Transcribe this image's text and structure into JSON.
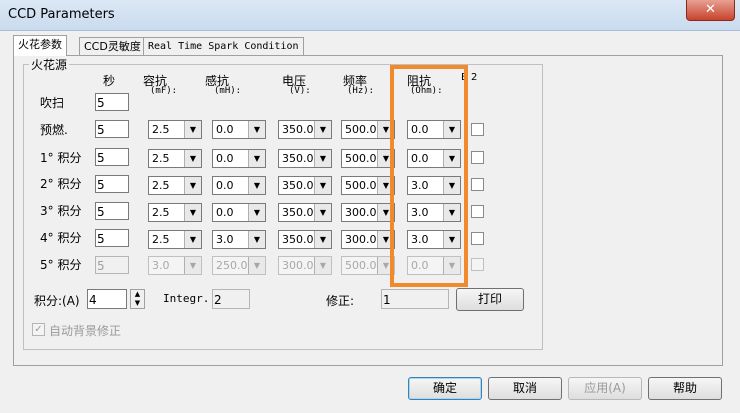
{
  "window": {
    "title": "CCD Parameters",
    "close": "✕"
  },
  "tabs": [
    "火花参数",
    "CCD灵敏度",
    "Real Time Spark Condition"
  ],
  "group_title": "火花源",
  "headers": {
    "sec": "秒",
    "capacitance": "容抗",
    "capacitance_unit": "(mF):",
    "inductance": "感抗",
    "inductance_unit": "(mH):",
    "voltage": "电压",
    "voltage_unit": "(V):",
    "frequency": "频率",
    "frequency_unit": "(Hz):",
    "resistance": "阻抗",
    "resistance_unit": "(Ohm):",
    "extra": "B 2"
  },
  "rows": [
    {
      "label": "吹扫",
      "sec": "5"
    },
    {
      "label": "预燃.",
      "sec": "5",
      "cap": "2.5",
      "ind": "0.0",
      "volt": "350.0",
      "freq": "500.0",
      "res": "0.0"
    },
    {
      "label": "1° 积分",
      "sec": "5",
      "cap": "2.5",
      "ind": "0.0",
      "volt": "350.0",
      "freq": "500.0",
      "res": "0.0"
    },
    {
      "label": "2° 积分",
      "sec": "5",
      "cap": "2.5",
      "ind": "0.0",
      "volt": "350.0",
      "freq": "500.0",
      "res": "3.0"
    },
    {
      "label": "3° 积分",
      "sec": "5",
      "cap": "2.5",
      "ind": "0.0",
      "volt": "350.0",
      "freq": "300.0",
      "res": "3.0"
    },
    {
      "label": "4° 积分",
      "sec": "5",
      "cap": "2.5",
      "ind": "3.0",
      "volt": "350.0",
      "freq": "300.0",
      "res": "3.0"
    },
    {
      "label": "5° 积分",
      "sec": "5",
      "cap": "3.0",
      "ind": "250.0",
      "volt": "300.0",
      "freq": "500.0",
      "res": "0.0"
    }
  ],
  "bottom": {
    "integral_label": "积分:(A)",
    "integral_value": "4",
    "integr_label": "Integr.",
    "integr_value": "2",
    "correction_label": "修正:",
    "correction_value": "1",
    "print_label": "打印",
    "auto_bg_label": "自动背景修正"
  },
  "footer": {
    "ok": "确定",
    "cancel": "取消",
    "apply": "应用(A)",
    "help": "帮助"
  }
}
